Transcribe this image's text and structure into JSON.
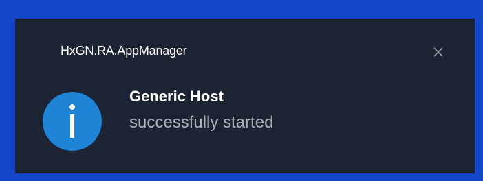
{
  "notification": {
    "app_name": "HxGN.RA.AppManager",
    "title": "Generic Host",
    "message": "successfully started",
    "icon": "info-icon",
    "close_icon": "close-icon"
  },
  "colors": {
    "border": "#1446c8",
    "background": "#1c2333",
    "accent": "#1e84d6",
    "title_text": "#ffffff",
    "message_text": "#a9b0bb"
  }
}
